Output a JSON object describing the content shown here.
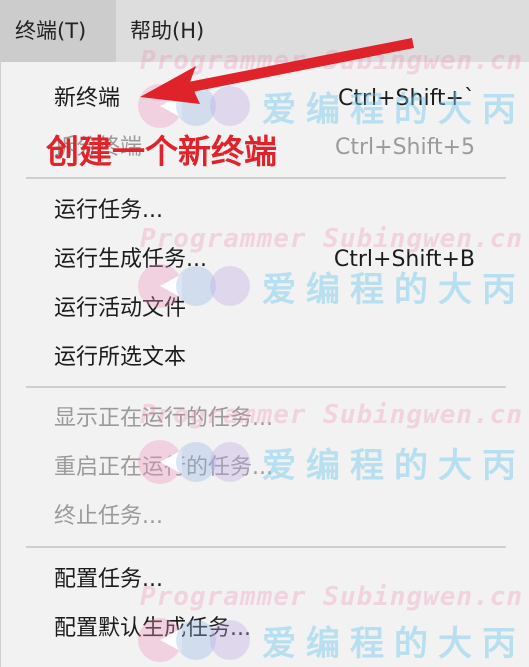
{
  "menubar": {
    "items": [
      {
        "label": "终端(T)"
      },
      {
        "label": "帮助(H)"
      }
    ]
  },
  "menu": {
    "items": [
      {
        "label": "新终端",
        "shortcut": "Ctrl+Shift+`",
        "enabled": true
      },
      {
        "label": "拆分终端",
        "shortcut": "Ctrl+Shift+5",
        "enabled": false
      },
      {
        "label": "运行任务...",
        "shortcut": "",
        "enabled": true
      },
      {
        "label": "运行生成任务...",
        "shortcut": "Ctrl+Shift+B",
        "enabled": true
      },
      {
        "label": "运行活动文件",
        "shortcut": "",
        "enabled": true
      },
      {
        "label": "运行所选文本",
        "shortcut": "",
        "enabled": true
      },
      {
        "label": "显示正在运行的任务...",
        "shortcut": "",
        "enabled": false
      },
      {
        "label": "重启正在运行的任务...",
        "shortcut": "",
        "enabled": false
      },
      {
        "label": "终止任务...",
        "shortcut": "",
        "enabled": false
      },
      {
        "label": "配置任务...",
        "shortcut": "",
        "enabled": true
      },
      {
        "label": "配置默认生成任务...",
        "shortcut": "",
        "enabled": true
      }
    ]
  },
  "annotation": {
    "text": "创建一个新终端",
    "color": "#e0232a"
  },
  "watermark": {
    "line1": "Programmer Subingwen.cn",
    "line2": "爱编程的大丙"
  }
}
